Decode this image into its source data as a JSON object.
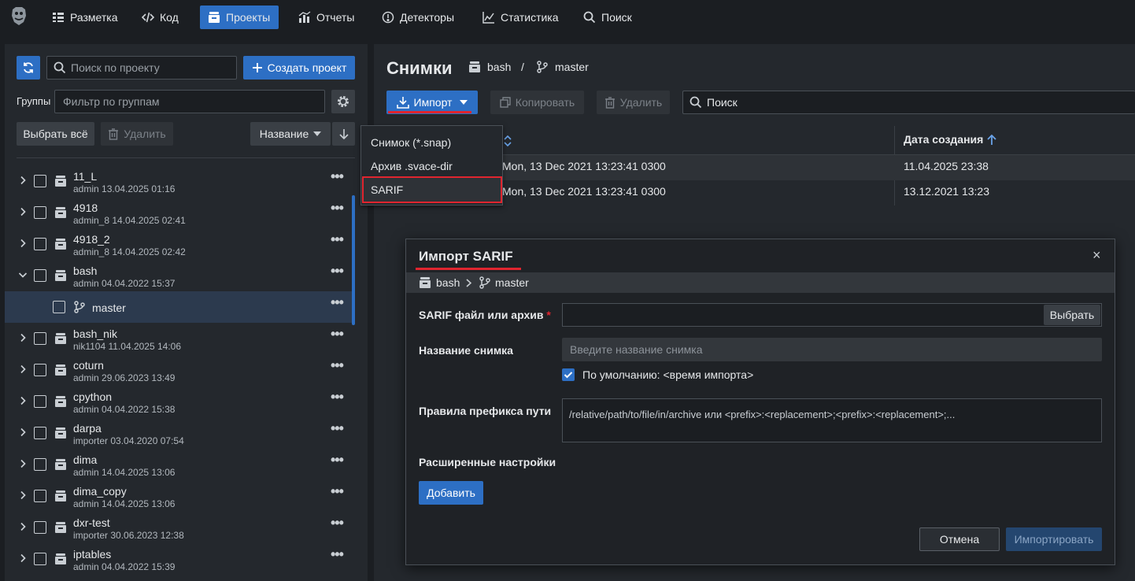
{
  "nav": {
    "items": [
      {
        "label": "Разметка",
        "icon": "layout-icon"
      },
      {
        "label": "Код",
        "icon": "code-icon"
      },
      {
        "label": "Проекты",
        "icon": "projects-icon",
        "active": true
      },
      {
        "label": "Отчеты",
        "icon": "reports-icon"
      },
      {
        "label": "Детекторы",
        "icon": "detectors-icon"
      },
      {
        "label": "Статистика",
        "icon": "statistics-icon"
      },
      {
        "label": "Поиск",
        "icon": "search-icon"
      }
    ]
  },
  "left": {
    "search_placeholder": "Поиск по проекту",
    "create_label": "Создать проект",
    "groups_label": "Группы",
    "groups_placeholder": "Фильтр по группам",
    "select_all": "Выбрать всё",
    "delete": "Удалить",
    "sort_label": "Название",
    "projects": [
      {
        "name": "11_L",
        "meta": "admin 13.04.2025 01:16"
      },
      {
        "name": "4918",
        "meta": "admin_8 14.04.2025 02:41"
      },
      {
        "name": "4918_2",
        "meta": "admin_8 14.04.2025 02:42"
      },
      {
        "name": "bash",
        "meta": "admin 04.04.2022 15:37",
        "expanded": true
      },
      {
        "name": "master",
        "branch": true,
        "selected": true
      },
      {
        "name": "bash_nik",
        "meta": "nik1104 11.04.2025 14:06"
      },
      {
        "name": "coturn",
        "meta": "admin 29.06.2023 13:49"
      },
      {
        "name": "cpython",
        "meta": "admin 04.04.2022 15:38"
      },
      {
        "name": "darpa",
        "meta": "importer 03.04.2020 07:54"
      },
      {
        "name": "dima",
        "meta": "admin 14.04.2025 13:06"
      },
      {
        "name": "dima_copy",
        "meta": "admin 14.04.2025 13:06"
      },
      {
        "name": "dxr-test",
        "meta": "importer 30.06.2023 12:38"
      },
      {
        "name": "iptables",
        "meta": "admin 04.04.2022 15:39"
      }
    ]
  },
  "right": {
    "title": "Снимки",
    "crumb_project": "bash",
    "crumb_sep": "/",
    "crumb_branch": "master",
    "import_label": "Импорт",
    "copy_label": "Копировать",
    "delete_label": "Удалить",
    "search_placeholder": "Поиск",
    "col_created": "Дата создания",
    "rows": [
      {
        "name": "Mon, 13 Dec 2021 13:23:41 0300",
        "created": "11.04.2025 23:38"
      },
      {
        "name": "Mon, 13 Dec 2021 13:23:41 0300",
        "created": "13.12.2021 13:23"
      }
    ]
  },
  "import_menu": {
    "items": [
      "Снимок (*.snap)",
      "Архив .svace-dir",
      "SARIF"
    ]
  },
  "dialog": {
    "title": "Импорт SARIF",
    "close": "×",
    "crumb_project": "bash",
    "crumb_branch": "master",
    "file_label": "SARIF файл или архив",
    "required_mark": "*",
    "choose_label": "Выбрать",
    "name_label": "Название снимка",
    "name_placeholder": "Введите название снимка",
    "default_checkbox": "По умолчанию: <время импорта>",
    "prefix_label": "Правила префикса пути",
    "prefix_placeholder": "/relative/path/to/file/in/archive или <prefix>:<replacement>;<prefix>:<replacement>;...",
    "advanced_label": "Расширенные настройки",
    "add_label": "Добавить",
    "cancel_label": "Отмена",
    "import_label": "Импортировать"
  },
  "colors": {
    "accent": "#2d6fc4",
    "highlight": "#e0252f",
    "background": "#1b1e22",
    "panel": "#24282d"
  }
}
